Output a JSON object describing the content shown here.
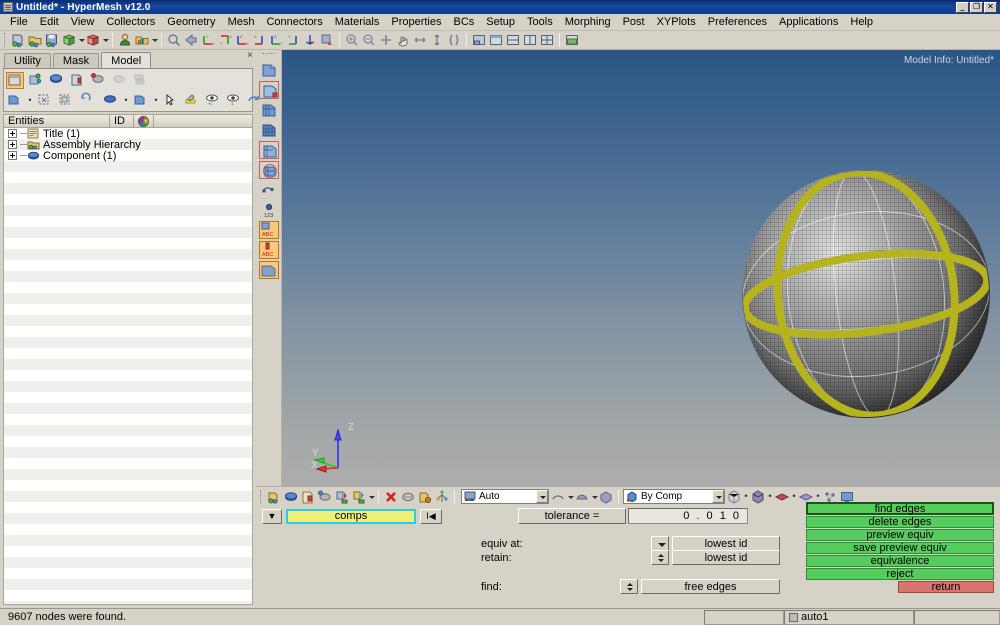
{
  "window": {
    "title": "Untitled* - HyperMesh v12.0",
    "icon": "application-icon",
    "buttons": [
      {
        "name": "minimize-button",
        "glyph": "_"
      },
      {
        "name": "restore-button",
        "glyph": "❐"
      },
      {
        "name": "close-button",
        "glyph": "✕"
      }
    ]
  },
  "menubar": {
    "items": [
      "File",
      "Edit",
      "View",
      "Collectors",
      "Geometry",
      "Mesh",
      "Connectors",
      "Materials",
      "Properties",
      "BCs",
      "Setup",
      "Tools",
      "Morphing",
      "Post",
      "XYPlots",
      "Preferences",
      "Applications",
      "Help"
    ]
  },
  "main_toolbar": {
    "icons": [
      "new-model-icon",
      "open-model-icon",
      "save-model-icon",
      "import-icon",
      "export-icon",
      "user-profile-icon",
      "color-settings-icon",
      "zoom-icon",
      "previous-view-icon",
      "view-xy-icon",
      "view-yx-icon",
      "view-zx-icon",
      "view-xz-icon",
      "view-yz-icon",
      "view-zy-icon",
      "view-iso-icon",
      "flag-view-icon",
      "fit-view-icon",
      "zoom-window-icon",
      "zoom-in-out-icon",
      "pan-icon",
      "rotate-icon",
      "arc-rotate-icon",
      "spin-icon",
      "clipping-icon",
      "save-window-layout-icon",
      "window-1-icon",
      "window-2-icon",
      "window-3-icon",
      "window-4-icon",
      "capture-image-icon"
    ]
  },
  "left_panel": {
    "close_label": "×",
    "tabs": [
      {
        "label": "Utility",
        "active": false,
        "name": "tab-utility"
      },
      {
        "label": "Mask",
        "active": false,
        "name": "tab-mask"
      },
      {
        "label": "Model",
        "active": true,
        "name": "tab-model"
      }
    ],
    "toolbar_row1": [
      "model-browser-icon",
      "component-icon",
      "solver-browser-icon",
      "include-icon",
      "part-browser-icon",
      "entity-state-icon",
      "collapse-all-icon"
    ],
    "toolbar_row2": [
      "display-all-icon",
      "isolate-icon",
      "isolate-only-icon",
      "reverse-icon",
      "color-by-icon",
      "component-display-icon",
      "pick-icon",
      "highlight-icon",
      "show-icon",
      "show-one-icon",
      "undo-icon"
    ],
    "columns": [
      "Entities",
      "ID",
      "color-wheel-icon",
      ""
    ],
    "tree": [
      {
        "label": "Title (1)",
        "icon": "title-icon",
        "expandable": true
      },
      {
        "label": "Assembly Hierarchy",
        "icon": "assembly-icon",
        "expandable": true
      },
      {
        "label": "Component (1)",
        "icon": "component-icon",
        "expandable": true
      }
    ]
  },
  "view_toolbar": {
    "icons": [
      "shaded-geom-icon",
      "shaded-geom-mesh-icon",
      "wireframe-icon",
      "wireframe-mesh-icon",
      "shaded-elements-icon",
      "mesh-lines-icon",
      "feature-lines-icon",
      "node-numbers-icon",
      "element-numbers-icon",
      "component-names-icon",
      "transparency-icon"
    ]
  },
  "viewport": {
    "model_info": "Model Info: Untitled*",
    "background_top": "#2b5584",
    "background_bottom": "#adadad",
    "mesh_color": "#808080",
    "highlight_edge_color": "#b5b31e",
    "triad": {
      "axes": [
        {
          "label": "Z",
          "color": "#3333ee"
        },
        {
          "label": "Y",
          "color": "#22cc22"
        },
        {
          "label": "X",
          "color": "#ee2222"
        }
      ]
    }
  },
  "bottom_toolbar": {
    "icons": [
      "collector-icon",
      "component-collector-icon",
      "include-collector-icon",
      "assembly-icon",
      "import-solver-icon",
      "export-solver-icon",
      "delete-icon",
      "organize-icon",
      "renumber-icon",
      "checks-icon"
    ],
    "mode_combo": {
      "value": "Auto",
      "icon": "auto-icon",
      "name": "mesh-mode-combo"
    },
    "shape_icons": [
      "shrink-icon",
      "surface-icon",
      "solid-icon"
    ],
    "color_combo": {
      "value": "By Comp",
      "icon": "by-comp-icon",
      "name": "color-mode-combo"
    },
    "display_icons": [
      "wireframe-mode-icon",
      "shaded-mode-icon",
      "shaded-edges-icon",
      "transparent-mode-icon",
      "nodes-mode-icon",
      "screen-mode-icon"
    ]
  },
  "panel": {
    "selector": {
      "arrow_name": "entity-type-dropdown",
      "value": "comps",
      "reset_label": "I◀"
    },
    "tolerance": {
      "button_label": "tolerance =",
      "value": "0 . 0 1 0"
    },
    "fields": [
      {
        "label": "equiv at:",
        "control": "down",
        "value": "lowest id",
        "name": "equiv-at-field"
      },
      {
        "label": "retain:",
        "control": "both",
        "value": "lowest id",
        "name": "retain-field"
      },
      {
        "label": "find:",
        "control": "both",
        "value": "free edges",
        "name": "find-field"
      }
    ],
    "actions": [
      {
        "label": "find edges",
        "style": "green-focus",
        "name": "find-edges-button"
      },
      {
        "label": "delete edges",
        "style": "green",
        "name": "delete-edges-button"
      },
      {
        "label": "preview equiv",
        "style": "green",
        "name": "preview-equiv-button"
      },
      {
        "label": "save preview equiv",
        "style": "green",
        "name": "save-preview-equiv-button"
      },
      {
        "label": "equivalence",
        "style": "green",
        "name": "equivalence-button"
      },
      {
        "label": "reject",
        "style": "green",
        "name": "reject-button"
      },
      {
        "label": "return",
        "style": "red",
        "name": "return-button"
      }
    ]
  },
  "statusbar": {
    "message": "9607 nodes were found.",
    "cell_empty": "",
    "mode": "auto1",
    "cell_trailing": ""
  }
}
